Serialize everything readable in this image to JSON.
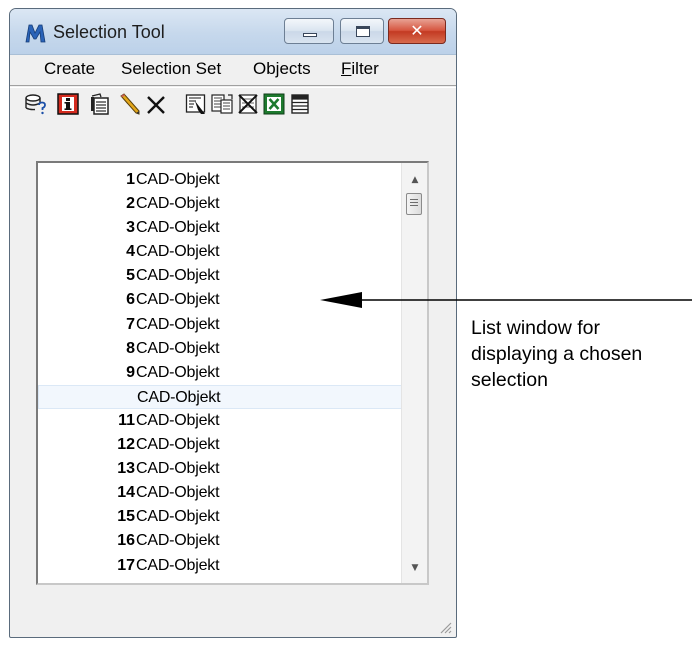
{
  "window": {
    "title": "Selection Tool",
    "close_glyph": "✕"
  },
  "menu": {
    "items": [
      {
        "label": "Create"
      },
      {
        "label": "Selection Set"
      },
      {
        "label": "Objects"
      },
      {
        "label": "Filter",
        "underline_prefix": "F",
        "rest": "ilter"
      }
    ]
  },
  "toolbar": {
    "icons": [
      "query-icon",
      "info-icon",
      "copy-icon",
      "pencil-icon",
      "delete-icon",
      "select-tool-icon",
      "select-set-icon",
      "clear-selection-icon",
      "excel-export-icon",
      "table-icon"
    ]
  },
  "list": {
    "rows": [
      {
        "num": "1",
        "label": "CAD-Objekt"
      },
      {
        "num": "2",
        "label": "CAD-Objekt"
      },
      {
        "num": "3",
        "label": "CAD-Objekt"
      },
      {
        "num": "4",
        "label": "CAD-Objekt"
      },
      {
        "num": "5",
        "label": "CAD-Objekt"
      },
      {
        "num": "6",
        "label": "CAD-Objekt"
      },
      {
        "num": "7",
        "label": "CAD-Objekt"
      },
      {
        "num": "8",
        "label": "CAD-Objekt"
      },
      {
        "num": "9",
        "label": "CAD-Objekt"
      },
      {
        "num": "",
        "label": "CAD-Objekt",
        "selected": true
      },
      {
        "num": "11",
        "label": "CAD-Objekt"
      },
      {
        "num": "12",
        "label": "CAD-Objekt"
      },
      {
        "num": "13",
        "label": "CAD-Objekt"
      },
      {
        "num": "14",
        "label": "CAD-Objekt"
      },
      {
        "num": "15",
        "label": "CAD-Objekt"
      },
      {
        "num": "16",
        "label": "CAD-Objekt"
      },
      {
        "num": "17",
        "label": "CAD-Objekt"
      }
    ]
  },
  "annotation": {
    "lines": [
      "List window for",
      "displaying a chosen",
      "selection"
    ]
  },
  "colors": {
    "titlebar": "#c6d8ec",
    "close_button": "#c33a22",
    "selected_row": "#f2f7fd",
    "window_bg": "#f0f0f0"
  }
}
